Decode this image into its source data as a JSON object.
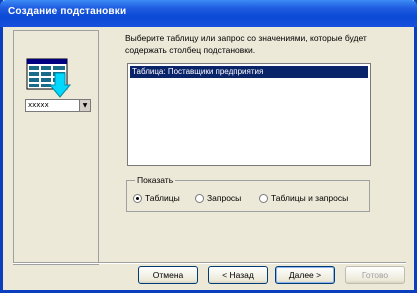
{
  "window": {
    "title": "Создание подстановки"
  },
  "left_panel": {
    "combo_value": "xxxxx"
  },
  "prompt": "Выберите таблицу или запрос со значениями, которые будет содержать столбец подстановки.",
  "list": {
    "items": [
      "Таблица: Поставщики предприятия"
    ],
    "selected_index": 0
  },
  "show_group": {
    "label": "Показать",
    "options": [
      {
        "label": "Таблицы",
        "checked": true
      },
      {
        "label": "Запросы",
        "checked": false
      },
      {
        "label": "Таблицы и запросы",
        "checked": false
      }
    ]
  },
  "buttons": {
    "cancel": "Отмена",
    "back": "< Назад",
    "next": "Далее >",
    "finish": "Готово"
  }
}
